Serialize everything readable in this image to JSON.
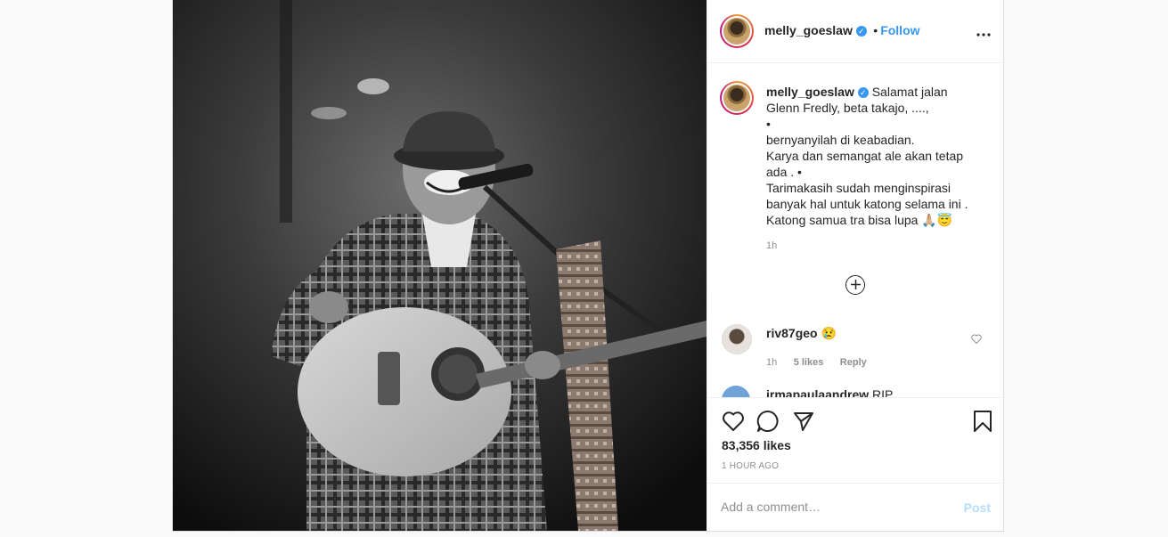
{
  "post": {
    "username": "melly_goeslaw",
    "follow_label": "Follow",
    "separator": "•",
    "more_label": "•••",
    "verified_mark": "✓"
  },
  "caption": {
    "username": "melly_goeslaw",
    "text": "Salamat jalan\nGlenn Fredly, beta takajo, ....,\n•\nbernyanyilah di keabadian.\nKarya dan semangat ale akan tetap\nada . •\nTarimakasih sudah menginspirasi\nbanyak hal untuk katong selama ini .\nKatong samua tra bisa lupa 🙏🏼😇",
    "time": "1h"
  },
  "load_more_icon": "plus-circle-icon",
  "comments": [
    {
      "username": "riv87geo",
      "text": "😢",
      "time": "1h",
      "likes": "5 likes",
      "reply": "Reply"
    },
    {
      "username": "irmapaulaandrew",
      "text": "RIP"
    }
  ],
  "actions": {
    "icons": [
      "heart-icon",
      "comment-icon",
      "share-icon",
      "bookmark-icon"
    ],
    "likes": "83,356 likes",
    "time_ago": "1 HOUR AGO"
  },
  "comment_box": {
    "placeholder": "Add a comment…",
    "post_label": "Post"
  },
  "colors": {
    "accent": "#3897f0",
    "post_disabled": "#b2dffc",
    "muted": "#8e8e8e"
  }
}
